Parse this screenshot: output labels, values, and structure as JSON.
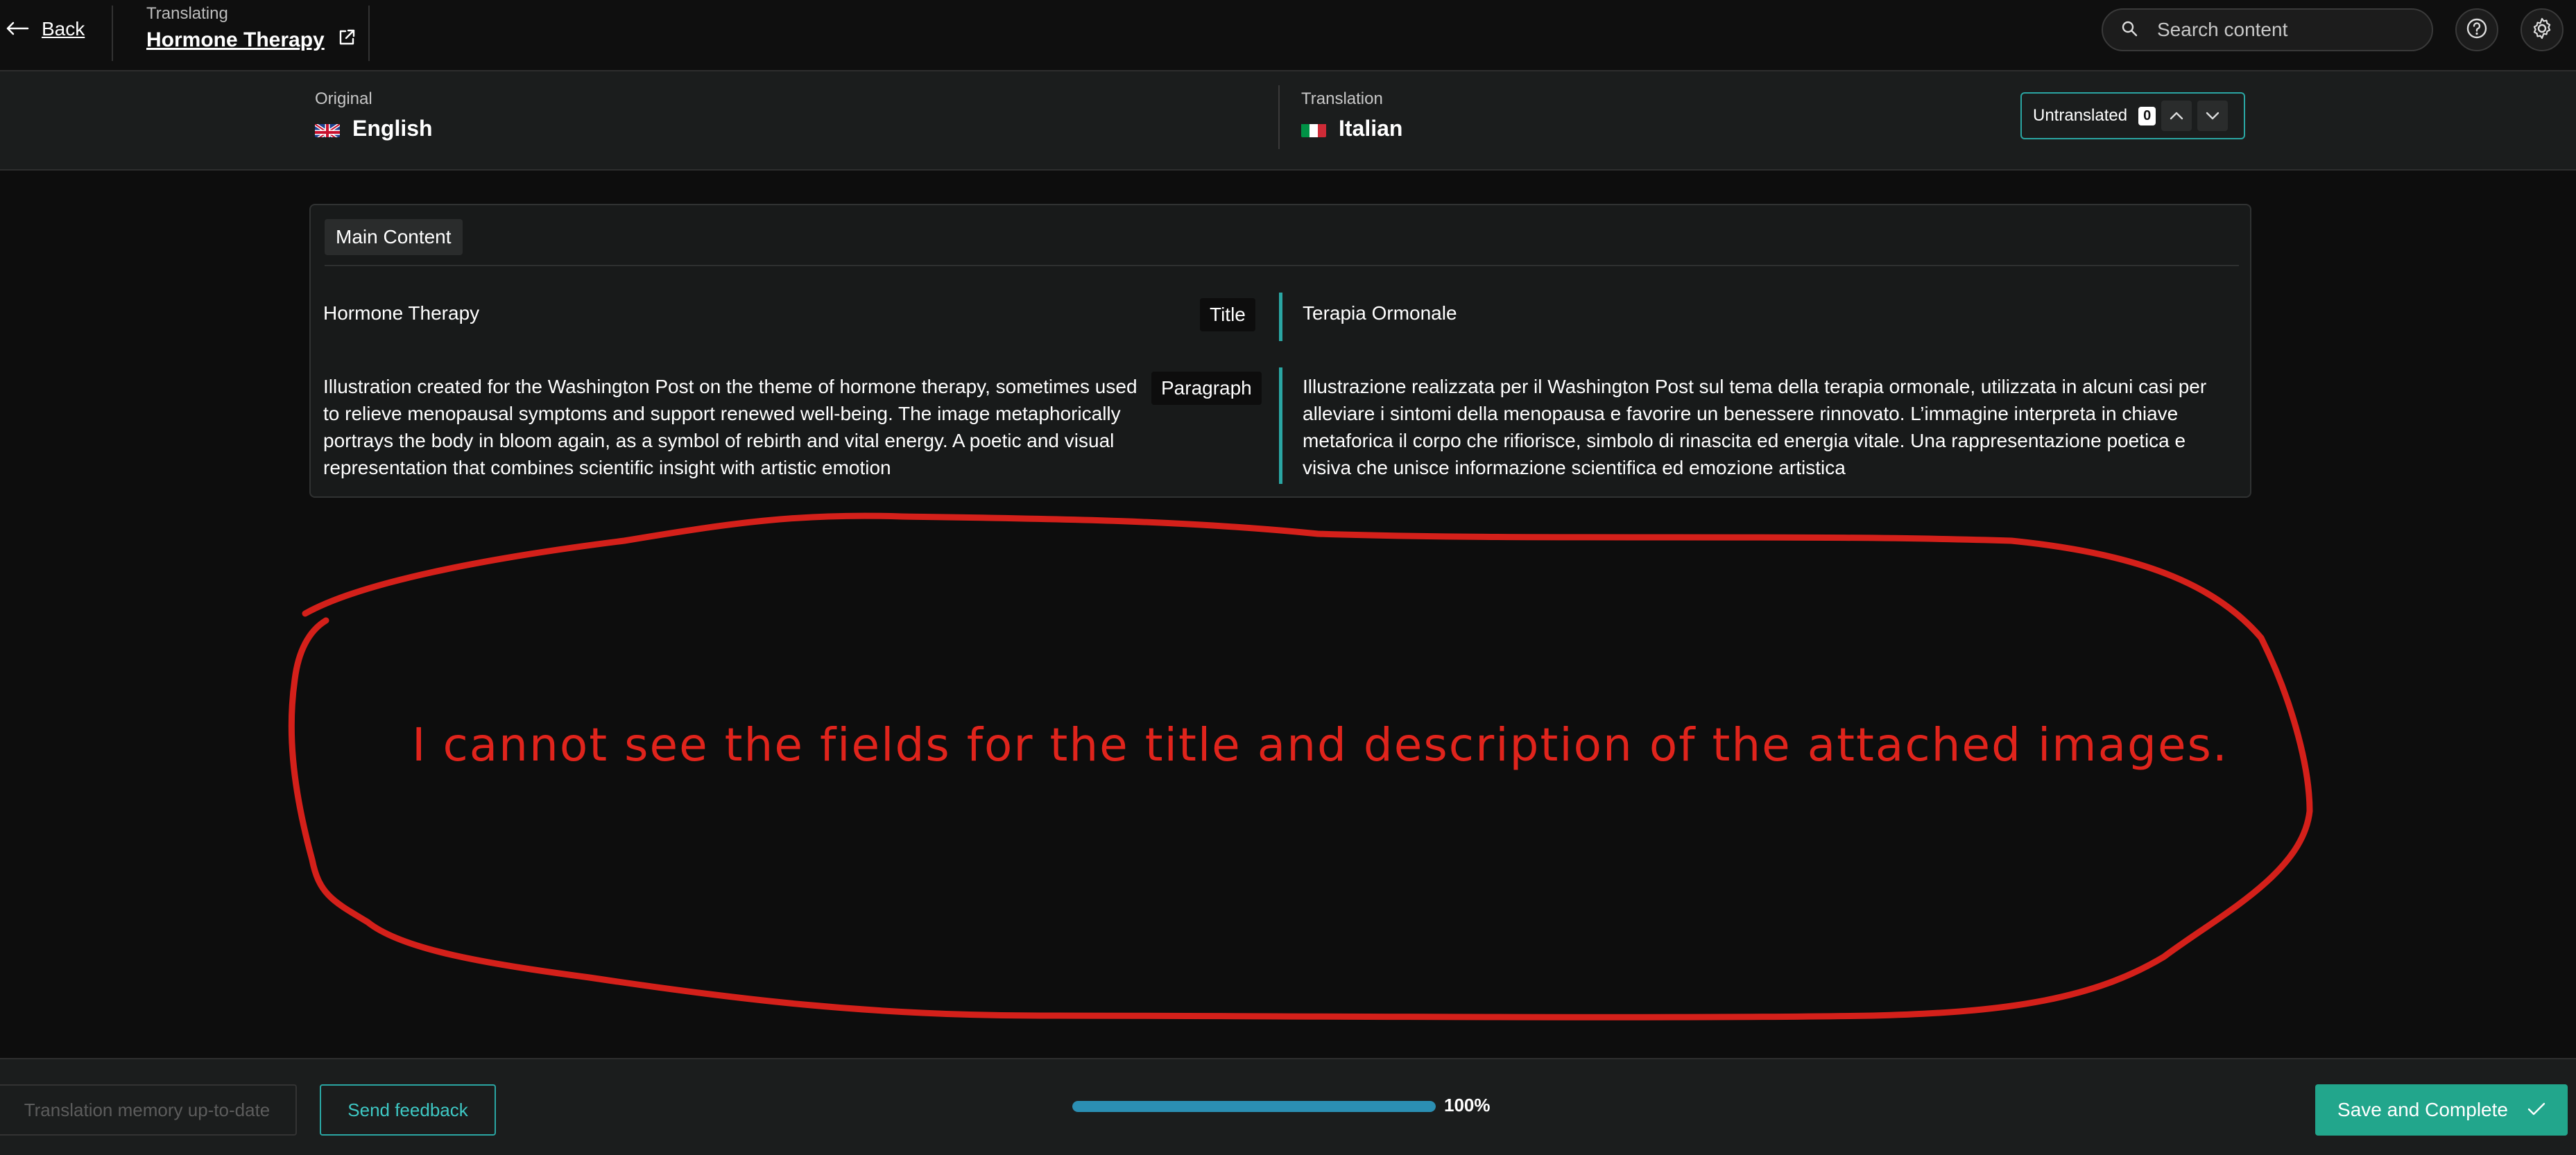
{
  "header": {
    "back_label": "Back",
    "translating_label": "Translating",
    "document_title": "Hormone Therapy",
    "search_placeholder": "Search content"
  },
  "languages": {
    "original_label": "Original",
    "original_name": "English",
    "translation_label": "Translation",
    "translation_name": "Italian"
  },
  "filter": {
    "label": "Untranslated",
    "count": "0"
  },
  "content": {
    "section_label": "Main Content",
    "rows": [
      {
        "type": "Title",
        "original": "Hormone Therapy",
        "translation": "Terapia Ormonale"
      },
      {
        "type": "Paragraph",
        "original": "Illustration created for the Washington Post on the theme of hormone therapy, sometimes used to relieve menopausal symptoms and support renewed well-being. The image metaphorically portrays the body in bloom again, as a symbol of rebirth and vital energy. A poetic and visual representation that combines scientific insight with artistic emotion",
        "translation": "Illustrazione realizzata per il Washington Post sul tema della terapia ormonale, utilizzata in alcuni casi per alleviare i sintomi della menopausa e favorire un benessere rinnovato. L’immagine interpreta in chiave metaforica il corpo che rifiorisce, simbolo di rinascita ed energia vitale. Una rappresentazione poetica e visiva che unisce informazione scientifica ed emozione artistica"
      }
    ]
  },
  "annotation": {
    "text": "I cannot see the fields for the title and description of the attached images.",
    "color": "#e0241c"
  },
  "footer": {
    "tm_label": "Translation memory up-to-date",
    "feedback_label": "Send feedback",
    "progress_percent": 100,
    "progress_label": "100%",
    "save_label": "Save and Complete"
  },
  "colors": {
    "accent_teal": "#2aa6a3",
    "save_green": "#22a68c",
    "progress_blue": "#2b8fb3"
  }
}
